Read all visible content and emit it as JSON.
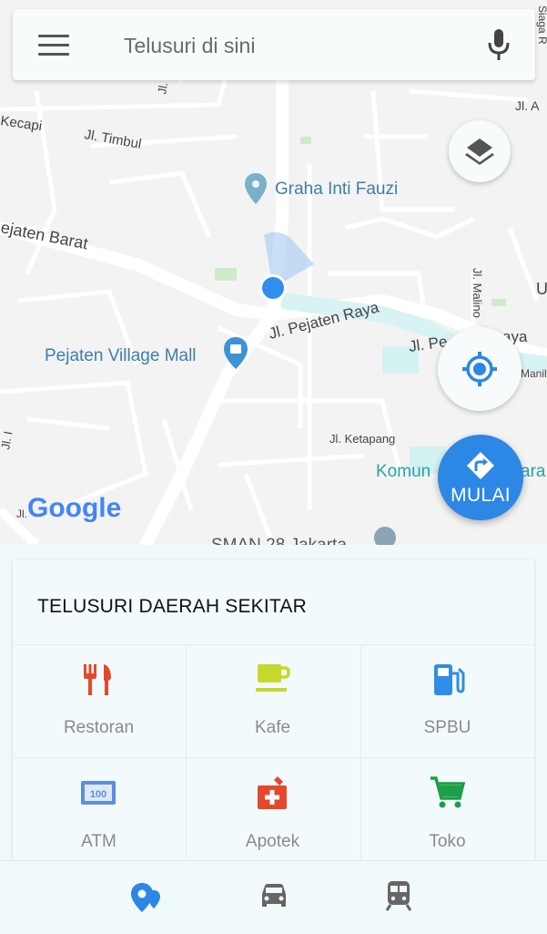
{
  "search": {
    "placeholder": "Telusuri di sini"
  },
  "map": {
    "streets": {
      "timbul": "Jl. Timbul",
      "kecapi": "Kecapi",
      "pejaten_barat": "ejaten Barat",
      "pejaten_raya": "Jl. Pejaten Raya",
      "pejaten_raya_2": "Jl. Pe",
      "raya_fragment": "aya",
      "ketapang": "Jl. Ketapang",
      "malino": "Jl. Malino",
      "jl_a": "Jl. A",
      "jl_i": "Jl. I",
      "jl_ja": "Jl. Ja",
      "jl_j": "Jl.",
      "manil": "Manil",
      "siaga": "Siaga R",
      "u": "U"
    },
    "places": {
      "graha": "Graha Inti Fauzi",
      "mall": "Pejaten Village Mall",
      "komunitas": "Komun",
      "komunitas_end": "ara",
      "sman": "SMAN 28 Jakarta"
    },
    "google_logo": "Google"
  },
  "start_button": {
    "label": "MULAI"
  },
  "explore": {
    "title": "TELUSURI DAERAH SEKITAR",
    "categories": [
      {
        "label": "Restoran",
        "icon": "restaurant-icon",
        "color": "#e5472d"
      },
      {
        "label": "Kafe",
        "icon": "cafe-icon",
        "color": "#c5d92c"
      },
      {
        "label": "SPBU",
        "icon": "gas-station-icon",
        "color": "#2e8de6"
      },
      {
        "label": "ATM",
        "icon": "atm-icon",
        "color": "#5a8fe0"
      },
      {
        "label": "Apotek",
        "icon": "pharmacy-icon",
        "color": "#e5472d"
      },
      {
        "label": "Toko",
        "icon": "shopping-cart-icon",
        "color": "#1e9e4a"
      }
    ]
  },
  "bottom_nav": [
    {
      "icon": "explore-pin-icon",
      "color": "#2c87e5"
    },
    {
      "icon": "car-icon",
      "color": "#666666"
    },
    {
      "icon": "train-icon",
      "color": "#666666"
    }
  ]
}
